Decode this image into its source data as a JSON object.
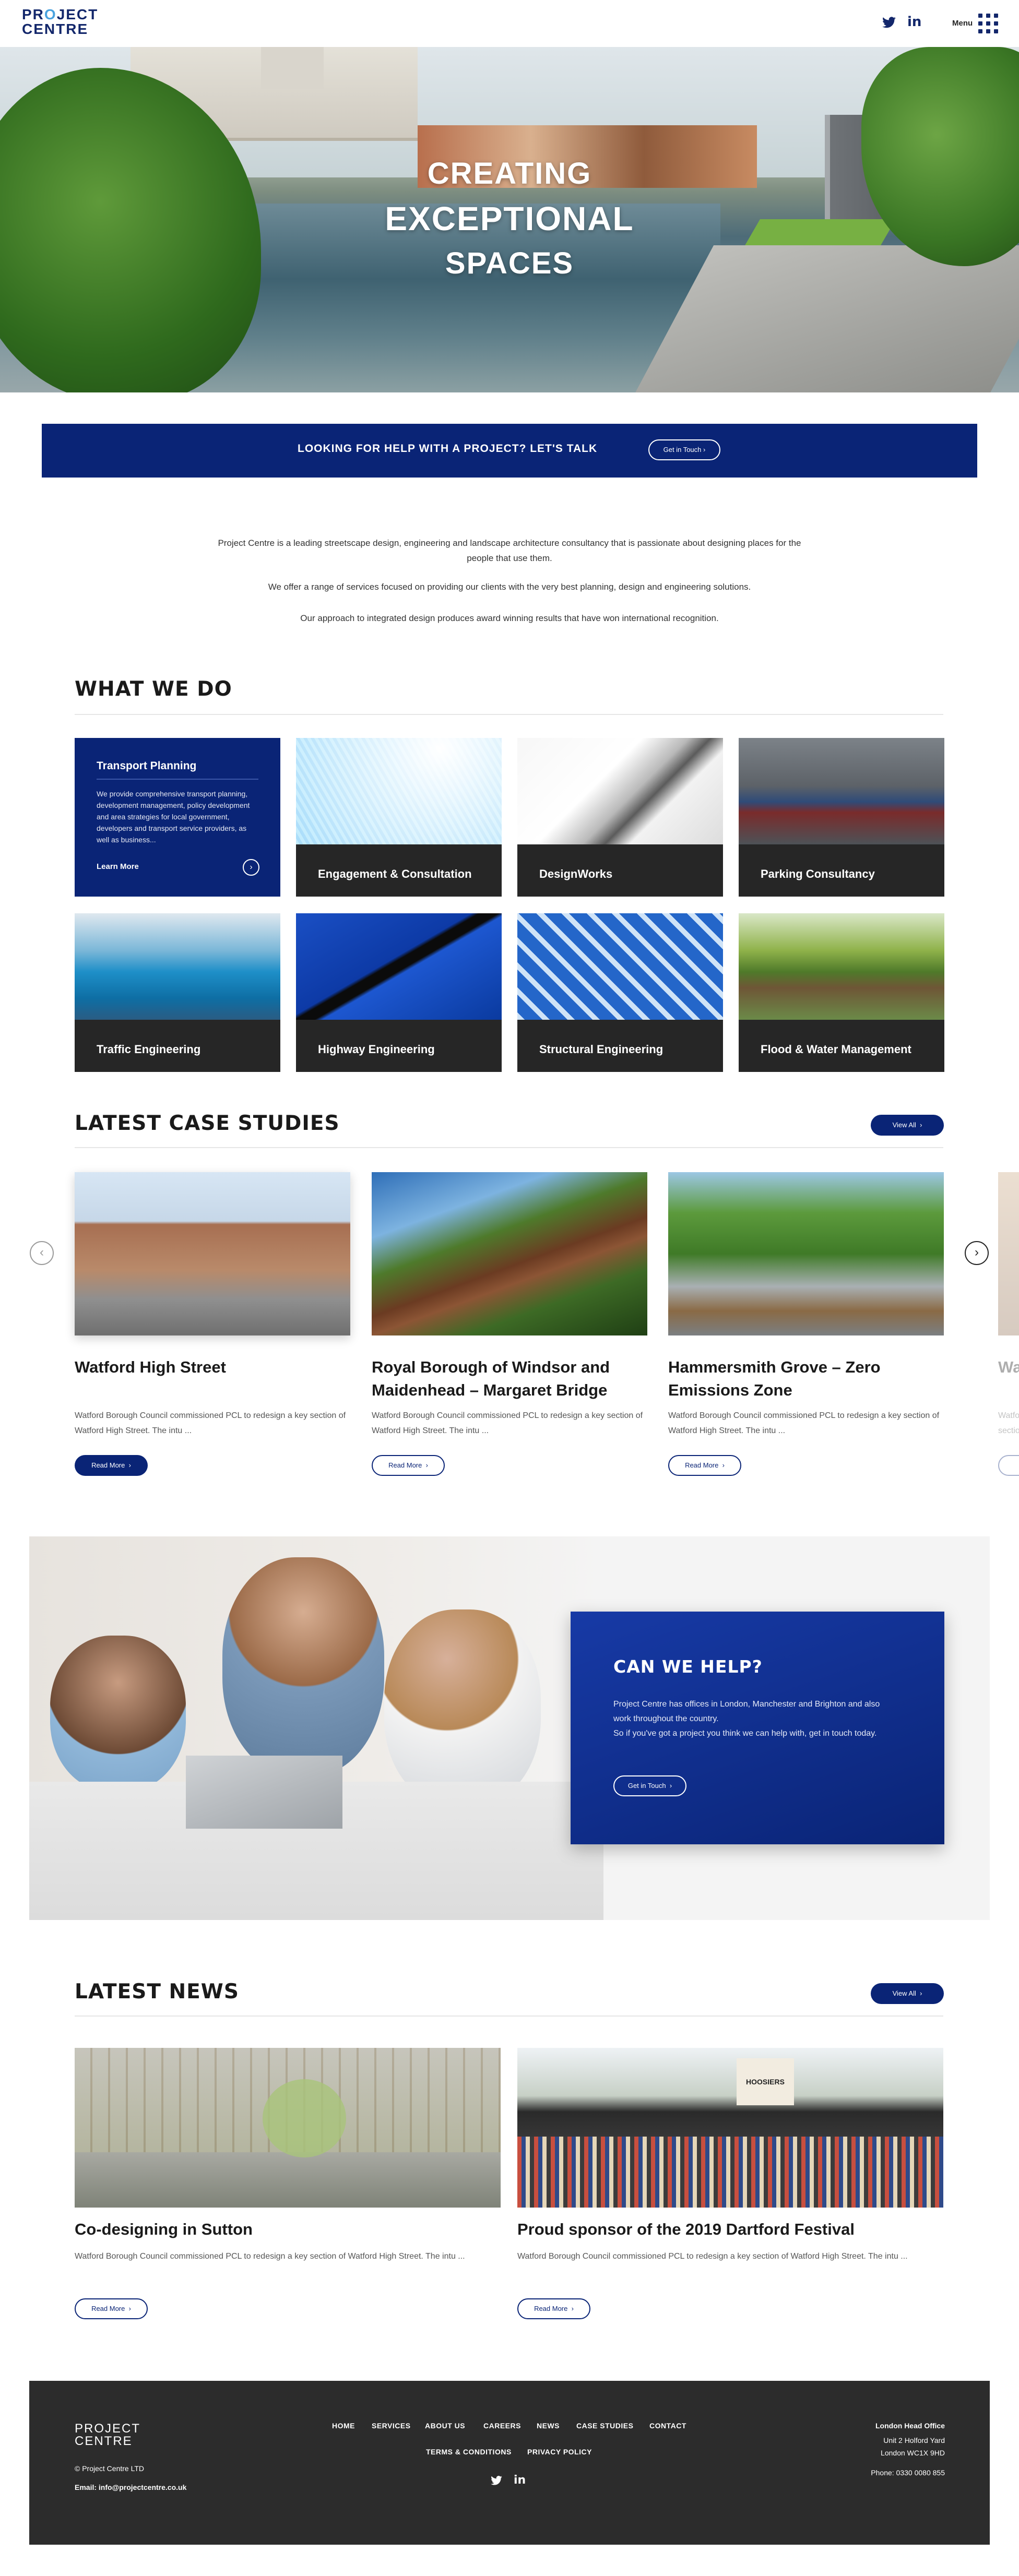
{
  "header": {
    "logo_line1": "PROJECT",
    "logo_line2": "CENTRE",
    "twitter_icon": "twitter-icon",
    "linkedin_icon": "linkedin-icon",
    "menu_label": "Menu"
  },
  "hero": {
    "line1": "CREATING",
    "line2": "EXCEPTIONAL",
    "line3": "SPACES"
  },
  "cta": {
    "text": "LOOKING FOR HELP WITH A PROJECT? LET'S TALK",
    "button": "Get in Touch"
  },
  "intro": {
    "p1": "Project Centre is a leading streetscape design, engineering and landscape architecture consultancy that is passionate about designing places for the people that use them.",
    "p2": "We offer a range of services focused on providing our clients with the very best planning, design and engineering solutions.",
    "p3": "Our approach to integrated design produces award winning results that have won international recognition."
  },
  "what_we_do": {
    "title": "WHAT WE DO",
    "featured": {
      "title": "Transport Planning",
      "desc": "We provide comprehensive transport planning, development management, policy development and area strategies for local government, developers and transport service providers, as well as business...",
      "link": "Learn More"
    },
    "cards": [
      "Engagement & Consultation",
      "DesignWorks",
      "Parking Consultancy",
      "Traffic Engineering",
      "Highway Engineering",
      "Structural Engineering",
      "Flood & Water Management"
    ]
  },
  "case_studies": {
    "title": "LATEST CASE STUDIES",
    "view_all": "View All",
    "items": [
      {
        "title": "Watford High Street",
        "desc": "Watford Borough Council commissioned PCL to redesign a key section of Watford High Street. The intu ...",
        "button": "Read More"
      },
      {
        "title": "Royal Borough of Windsor and Maidenhead – Margaret Bridge",
        "desc": "Watford Borough Council commissioned PCL to redesign a key section of Watford High Street. The intu ...",
        "button": "Read More"
      },
      {
        "title": "Hammersmith Grove – Zero Emissions Zone",
        "desc": "Watford Borough Council commissioned PCL to redesign a key section of Watford High Street. The intu ...",
        "button": "Read More"
      },
      {
        "title": "Wa",
        "desc": "Watfo",
        "desc2": "sectio",
        "button": "R"
      }
    ]
  },
  "help": {
    "title": "CAN WE HELP?",
    "p1": "Project Centre has offices in London, Manchester and Brighton and also work throughout the country.",
    "p2": "So if you've got a project you think we can help with, get in touch today.",
    "button": "Get in Touch"
  },
  "news": {
    "title": "LATEST NEWS",
    "view_all": "View All",
    "items": [
      {
        "title": "Co-designing in Sutton",
        "desc": "Watford Borough Council commissioned PCL to redesign a key section of Watford High Street. The intu ...",
        "button": "Read More"
      },
      {
        "title": "Proud sponsor of the 2019 Dartford Festival",
        "desc": "Watford Borough Council commissioned PCL to redesign a key section of Watford High Street. The intu ...",
        "button": "Read More",
        "sign": "HOOSIERS"
      }
    ]
  },
  "footer": {
    "logo_line1": "PROJECT",
    "logo_line2": "CENTRE",
    "copyright": "© Project Centre LTD",
    "email": "Email: info@projectcentre.co.uk",
    "nav": [
      "HOME",
      "SERVICES",
      "ABOUT US",
      "CAREERS",
      "NEWS",
      "CASE STUDIES",
      "CONTACT"
    ],
    "nav2": [
      "TERMS & CONDITIONS",
      "PRIVACY POLICY"
    ],
    "office_title": "London Head Office",
    "addr1": "Unit 2 Holford Yard",
    "addr2": "London WC1X 9HD",
    "phone": "Phone: 0330 0080 855"
  },
  "colors": {
    "navy": "#0a2476",
    "accent": "#4aa3df",
    "dark": "#2c2c2c"
  }
}
